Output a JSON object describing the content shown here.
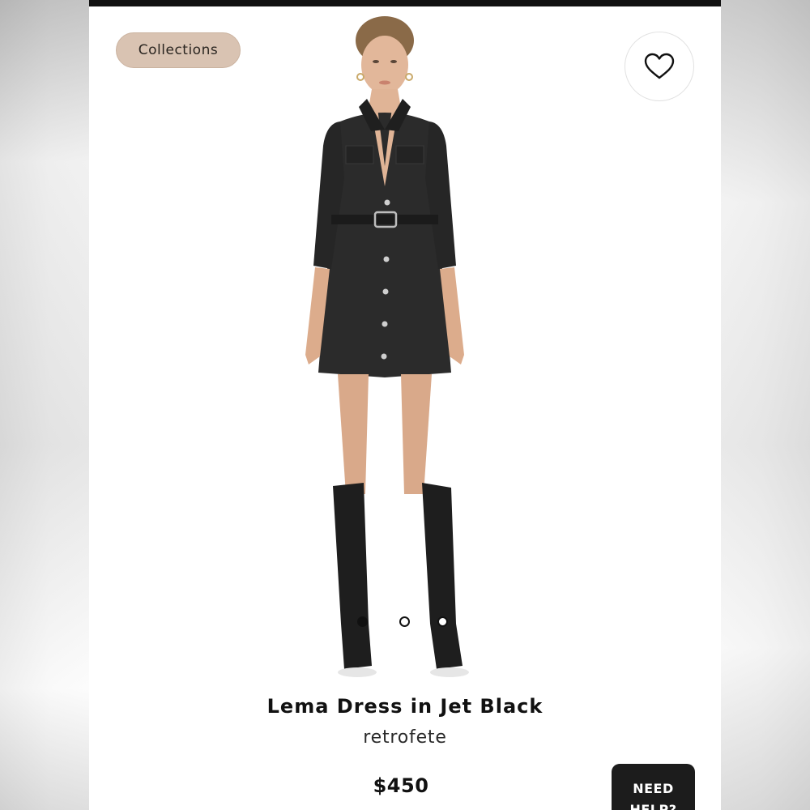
{
  "collections_chip": {
    "label": "Collections"
  },
  "wishlist": {
    "icon": "heart-outline-icon"
  },
  "product": {
    "name": "Lema Dress in Jet Black",
    "brand": "retrofete",
    "price": "$450",
    "image_description": "model-wearing-black-denim-dress-and-knee-boots"
  },
  "carousel": {
    "total": 3,
    "active_index": 0
  },
  "help_button": {
    "label": "NEED HELP?"
  },
  "colors": {
    "chip_bg": "#d9c3b2",
    "help_bg": "#1c1c1c",
    "topbar": "#111111"
  }
}
